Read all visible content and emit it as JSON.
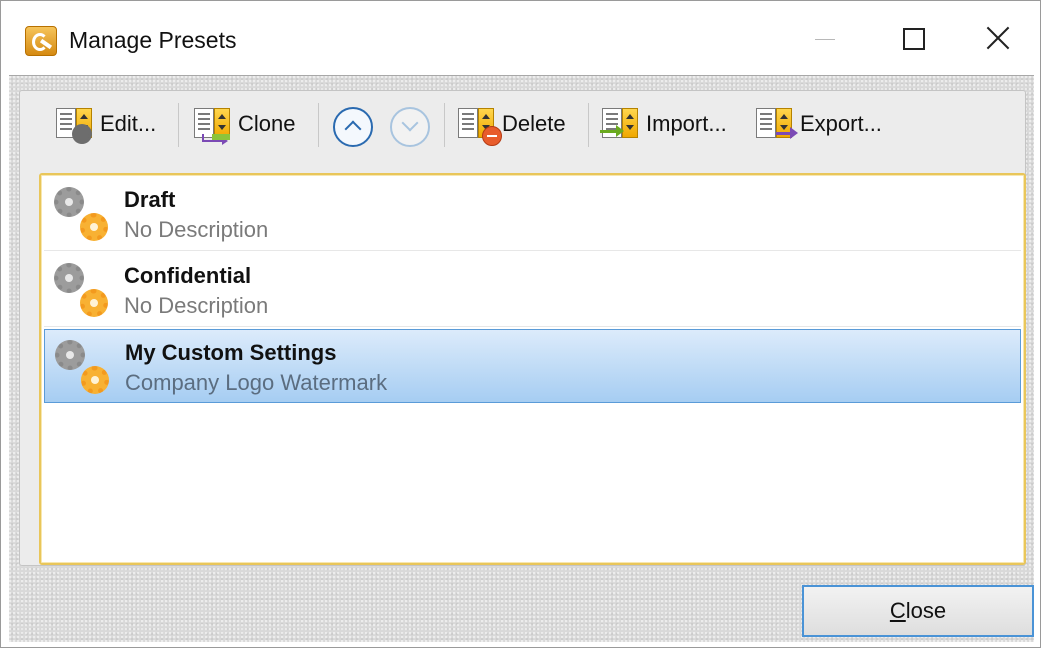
{
  "window": {
    "title": "Manage Presets"
  },
  "toolbar": {
    "edit_label": "Edit...",
    "clone_label": "Clone",
    "delete_label": "Delete",
    "import_label": "Import...",
    "export_label": "Export..."
  },
  "presets": {
    "items": [
      {
        "name": "Draft",
        "description": "No Description",
        "selected": false
      },
      {
        "name": "Confidential",
        "description": "No Description",
        "selected": false
      },
      {
        "name": "My Custom Settings",
        "description": "Company Logo Watermark",
        "selected": true
      }
    ]
  },
  "footer": {
    "close_mnemonic": "C",
    "close_rest": "lose"
  },
  "colors": {
    "selection_border": "#5a9bd8",
    "list_border": "#e9c65a",
    "accent_orange": "#f39a1e"
  }
}
